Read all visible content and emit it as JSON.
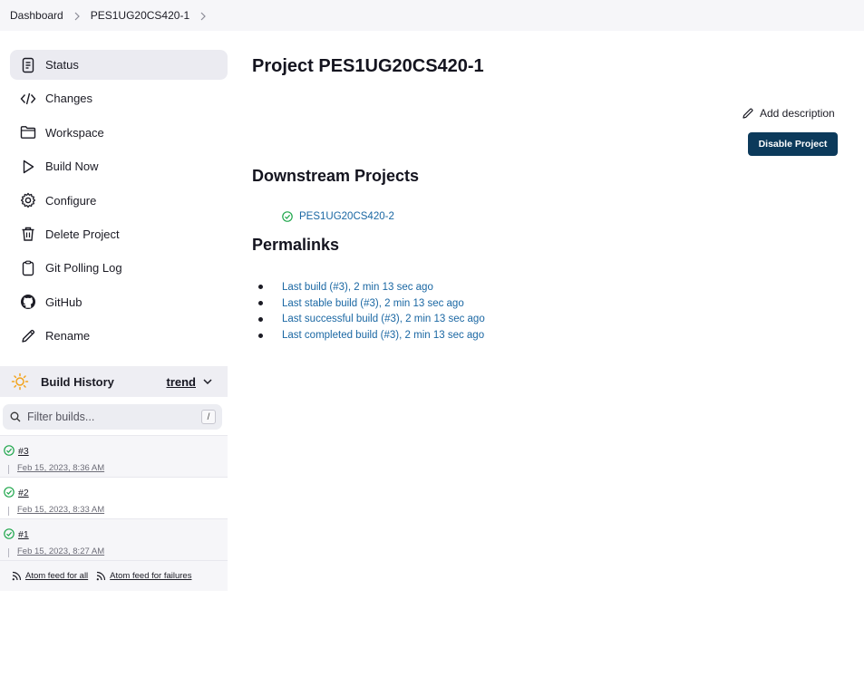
{
  "breadcrumb": {
    "items": [
      "Dashboard",
      "PES1UG20CS420-1"
    ]
  },
  "sidebar": {
    "items": [
      {
        "label": "Status",
        "icon": "status-icon",
        "active": true
      },
      {
        "label": "Changes",
        "icon": "code-icon"
      },
      {
        "label": "Workspace",
        "icon": "folder-icon"
      },
      {
        "label": "Build Now",
        "icon": "play-icon"
      },
      {
        "label": "Configure",
        "icon": "gear-icon"
      },
      {
        "label": "Delete Project",
        "icon": "trash-icon"
      },
      {
        "label": "Git Polling Log",
        "icon": "clipboard-icon"
      },
      {
        "label": "GitHub",
        "icon": "github-icon"
      },
      {
        "label": "Rename",
        "icon": "pencil-icon"
      }
    ]
  },
  "build_history": {
    "title": "Build History",
    "trend_label": "trend",
    "filter_placeholder": "Filter builds...",
    "filter_shortcut": "/",
    "builds": [
      {
        "number": "#3",
        "date": "Feb 15, 2023, 8:36 AM",
        "status": "success"
      },
      {
        "number": "#2",
        "date": "Feb 15, 2023, 8:33 AM",
        "status": "success"
      },
      {
        "number": "#1",
        "date": "Feb 15, 2023, 8:27 AM",
        "status": "success"
      }
    ],
    "feeds": {
      "all": "Atom feed for all",
      "failures": "Atom feed for failures"
    }
  },
  "main": {
    "title": "Project PES1UG20CS420-1",
    "add_description": "Add description",
    "disable_button": "Disable Project",
    "downstream_heading": "Downstream Projects",
    "downstream_projects": [
      "PES1UG20CS420-2"
    ],
    "permalinks_heading": "Permalinks",
    "permalinks": [
      "Last build (#3), 2 min 13 sec ago",
      "Last stable build (#3), 2 min 13 sec ago",
      "Last successful build (#3), 2 min 13 sec ago",
      "Last completed build (#3), 2 min 13 sec ago"
    ]
  },
  "colors": {
    "accent_button": "#0c3a5b",
    "link": "#1a67a3",
    "success": "#1ea64b"
  }
}
